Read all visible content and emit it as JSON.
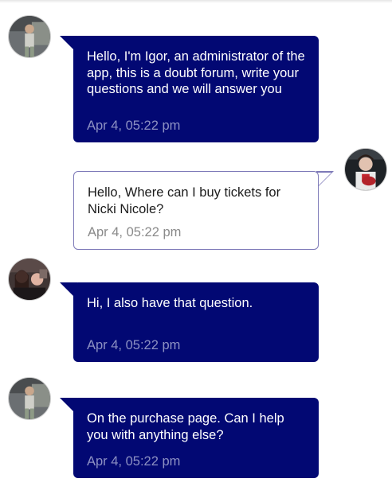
{
  "messages": [
    {
      "sender": "Igor",
      "direction": "incoming",
      "avatar": "avatar-man-icon",
      "text": "Hello, I'm Igor, an administrator of the app, this is a doubt forum, write your questions and we will answer you",
      "time": "Apr 4, 05:22 pm"
    },
    {
      "sender": "me",
      "direction": "outgoing",
      "avatar": "avatar-guitar-icon",
      "text": "Hello, Where can I buy tickets for Nicki Nicole?",
      "time": "Apr 4, 05:22 pm"
    },
    {
      "sender": "user",
      "direction": "incoming",
      "avatar": "avatar-group-icon",
      "text": "Hi, I also have that question.",
      "time": "Apr 4, 05:22 pm"
    },
    {
      "sender": "Igor",
      "direction": "incoming",
      "avatar": "avatar-man-icon",
      "text": "On the purchase page. Can I help you with anything else?",
      "time": "Apr 4, 05:22 pm"
    }
  ],
  "colors": {
    "incoming_bubble": "#020873",
    "incoming_text": "#ffffff",
    "incoming_time": "#8d91c3",
    "outgoing_border": "#7d79b8",
    "outgoing_time": "#8a8a8a"
  }
}
